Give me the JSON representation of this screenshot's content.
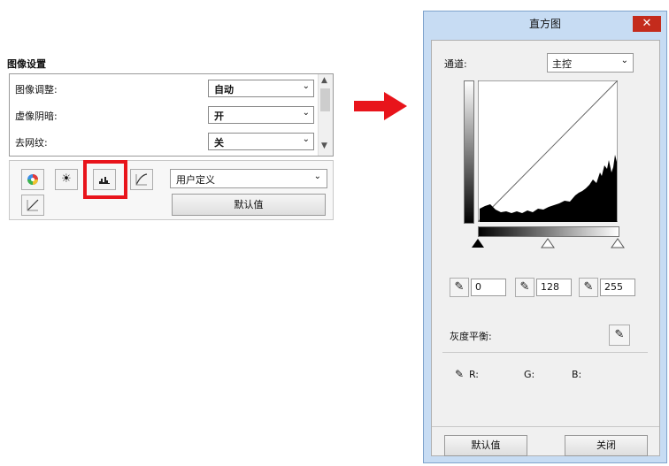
{
  "left_panel": {
    "title": "图像设置",
    "rows": [
      {
        "label": "图像调整:",
        "value": "自动"
      },
      {
        "label": "虚像阴暗:",
        "value": "开"
      },
      {
        "label": "去网纹:",
        "value": "关"
      }
    ],
    "preset_value": "用户定义",
    "default_button": "默认值"
  },
  "histogram_window": {
    "title": "直方图",
    "close_symbol": "✕",
    "channel_label": "通道:",
    "channel_value": "主控",
    "black_point": "0",
    "mid_point": "128",
    "white_point": "255",
    "gray_balance_label": "灰度平衡:",
    "rgb_labels": {
      "r": "R:",
      "g": "G:",
      "b": "B:"
    },
    "default_button": "默认值",
    "close_button": "关闭"
  },
  "colors": {
    "highlight": "#e8141b",
    "arrow": "#e8141b",
    "close_bg": "#c42b1c",
    "window_frame": "#c7dcf3"
  }
}
